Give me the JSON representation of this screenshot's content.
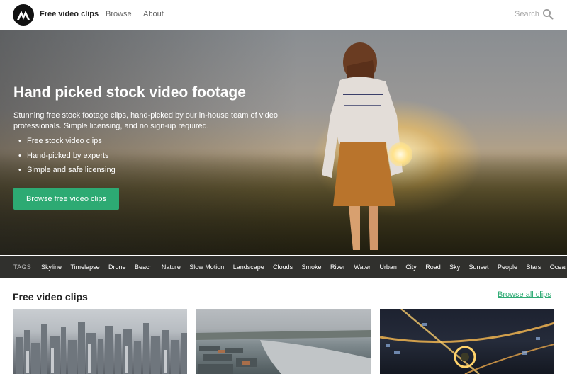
{
  "nav": {
    "brand": "Free video clips",
    "links": [
      "Browse",
      "About"
    ],
    "search_placeholder": "Search"
  },
  "hero": {
    "title": "Hand picked stock video footage",
    "subtitle": "Stunning free stock footage clips, hand-picked by our in-house team of video professionals. Simple licensing, and no sign-up required.",
    "bullets": [
      "Free stock video clips",
      "Hand-picked by experts",
      "Simple and safe licensing"
    ],
    "cta": "Browse free video clips"
  },
  "tags": {
    "label": "TAGS",
    "items": [
      "Skyline",
      "Timelapse",
      "Drone",
      "Beach",
      "Nature",
      "Slow Motion",
      "Landscape",
      "Clouds",
      "Smoke",
      "River",
      "Water",
      "Urban",
      "City",
      "Road",
      "Sky",
      "Sunset",
      "People",
      "Stars",
      "Ocean"
    ]
  },
  "section": {
    "title": "Free video clips",
    "browse_all": "Browse all clips"
  },
  "colors": {
    "accent": "#2daa73",
    "tags_bar": "#1a1a17"
  }
}
